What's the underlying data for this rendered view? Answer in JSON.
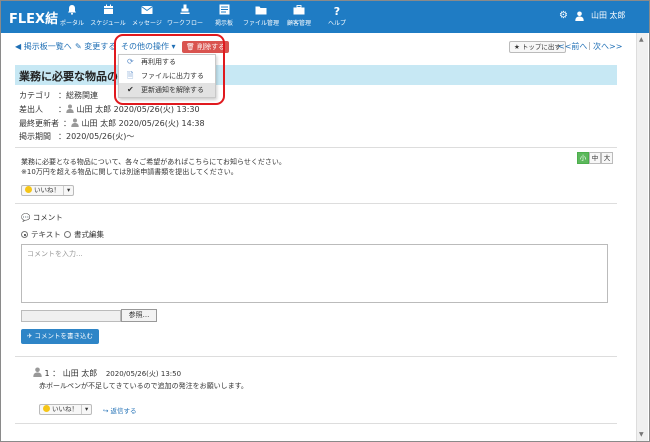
{
  "app": {
    "brand": "FLEX結"
  },
  "nav": [
    {
      "label": "ポータル",
      "icon": "bell-icon"
    },
    {
      "label": "スケジュール",
      "icon": "calendar-icon"
    },
    {
      "label": "メッセージ",
      "icon": "envelope-icon"
    },
    {
      "label": "ワークフロー",
      "icon": "stamp-icon"
    },
    {
      "label": "掲示板",
      "icon": "board-icon"
    },
    {
      "label": "ファイル管理",
      "icon": "folder-icon"
    },
    {
      "label": "顧客管理",
      "icon": "briefcase-icon"
    },
    {
      "label": "ヘルプ",
      "icon": "question-icon"
    }
  ],
  "user": {
    "name": "山田 太郎"
  },
  "toolbar": {
    "back": "◀ 掲示板一覧へ",
    "edit": "変更する",
    "other_ops": "その他の操作 ▾",
    "delete": "削除する",
    "pin_top": "トップに出す",
    "prev": "<<前へ",
    "next": "次へ>>",
    "sep": "|"
  },
  "menu": {
    "items": [
      {
        "label": "再利用する",
        "icon": "refresh-icon"
      },
      {
        "label": "ファイルに出力する",
        "icon": "file-icon"
      },
      {
        "label": "更新通知を解除する",
        "icon": "check-icon"
      }
    ]
  },
  "post": {
    "title": "業務に必要な物品の募集",
    "category_label": "カテゴリ",
    "category": "：総務関連",
    "author_label": "差出人",
    "author": "山田 太郎 2020/05/26(火) 13:30",
    "updated_label": "最終更新者",
    "updated": "山田 太郎 2020/05/26(火) 14:38",
    "period_label": "掲示期間",
    "period": "：2020/05/26(火)～",
    "colon": "："
  },
  "body": {
    "line1": "業務に必要となる物品について、各々ご希望があればこちらにてお知らせください。",
    "line2": "※10万円を超える物品に関しては別途申請書類を提出してください。"
  },
  "font_size": {
    "small": "小",
    "medium": "中",
    "large": "大"
  },
  "like": {
    "label": "いいね！",
    "caret": "▾"
  },
  "comment_section": {
    "heading": "コメント",
    "mode_text": "テキスト",
    "mode_rich": "書式編集",
    "placeholder": "コメントを入力...",
    "browse": "参照...",
    "submit": "コメントを書き込む"
  },
  "comments": [
    {
      "no": "1 ：",
      "author": "山田 太郎",
      "date": "2020/05/26(火) 13:50",
      "text": "赤ボールペンが不足してきているので追加の発注をお願いします。",
      "reply": "返信する"
    }
  ]
}
